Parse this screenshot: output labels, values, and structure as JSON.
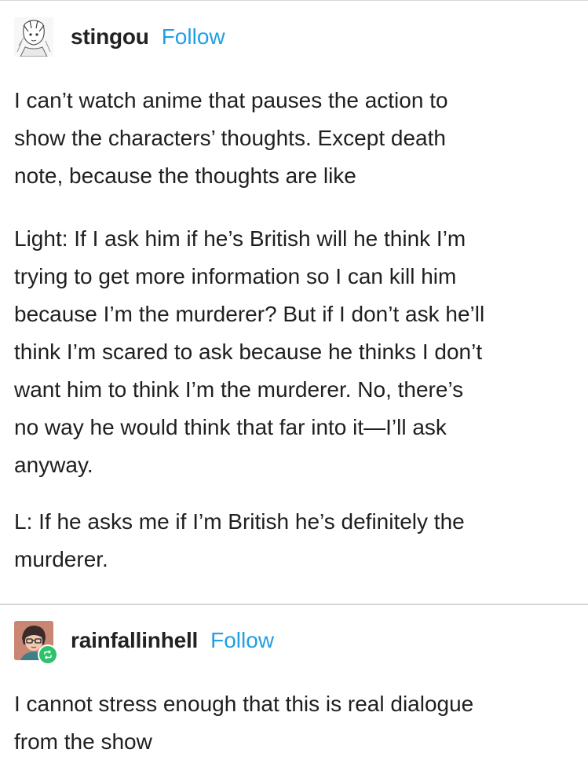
{
  "posts": [
    {
      "avatar_icon": "manga-character-avatar-icon",
      "username": "stingou",
      "follow_label": "Follow",
      "paragraphs": [
        {
          "lines": [
            "I can’t watch anime that pauses the action to",
            "show the characters’ thoughts. Except death",
            "note, because the thoughts are like"
          ]
        },
        {
          "lines": [
            "Light: If I ask him if he’s British will he think I’m",
            "trying to get more information so I can kill him",
            "because I’m the murderer? But if I don’t ask he’ll",
            "think I’m scared to ask because he thinks I don’t",
            "want him to think I’m the murderer. No, there’s",
            "no way he would think that far into it—I’ll ask",
            "anyway."
          ]
        },
        {
          "lines": [
            "L: If he asks me if I’m British he’s definitely the",
            "murderer."
          ]
        }
      ]
    },
    {
      "avatar_icon": "cartoon-person-avatar-icon",
      "reblog_icon": "reblog-icon",
      "username": "rainfallinhell",
      "follow_label": "Follow",
      "paragraphs": [
        {
          "lines": [
            "I cannot stress enough that this is real dialogue",
            "from the show"
          ]
        }
      ]
    }
  ],
  "colors": {
    "follow": "#1f9fe6",
    "text": "#1f1f1f",
    "divider": "#d6d6d6",
    "reblog_badge": "#2fc16b"
  }
}
